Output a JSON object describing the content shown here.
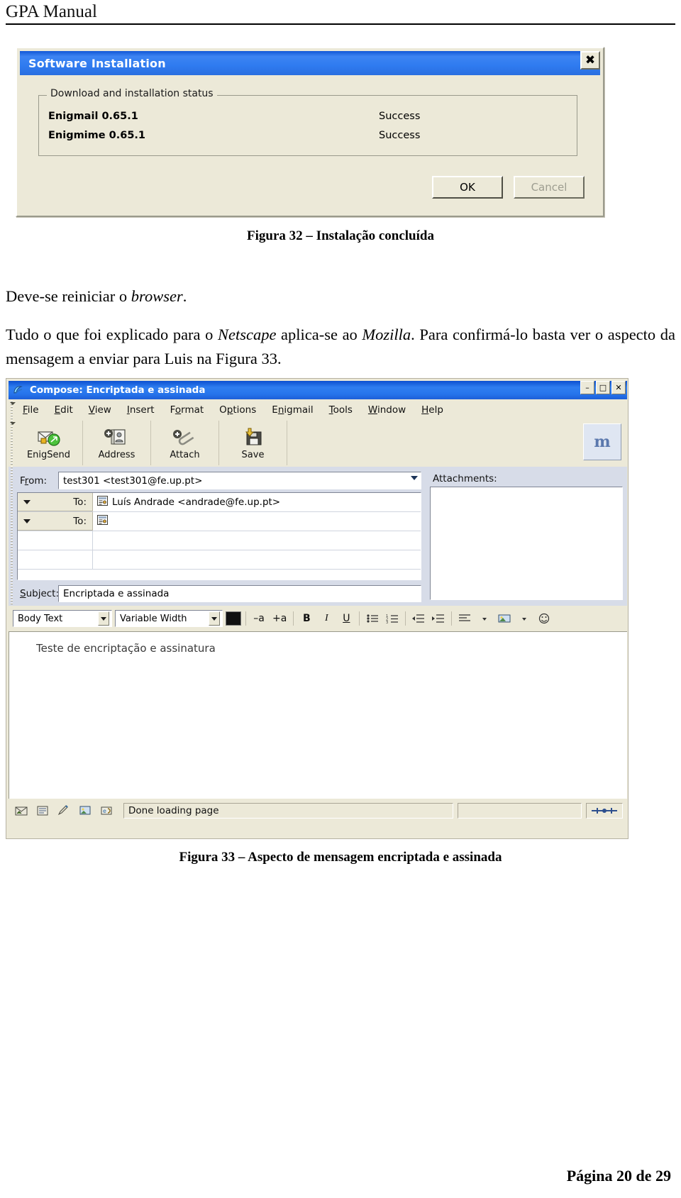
{
  "header": {
    "title": "GPA Manual"
  },
  "figure32": {
    "window_title": "Software Installation",
    "close_icon": "close-icon",
    "close_glyph": "✖",
    "group_legend": "Download and installation status",
    "items": [
      {
        "name": "Enigmail 0.65.1",
        "status": "Success"
      },
      {
        "name": "Enigmime 0.65.1",
        "status": "Success"
      }
    ],
    "ok_label": "OK",
    "cancel_label": "Cancel",
    "caption": "Figura 32 – Instalação concluída"
  },
  "body": {
    "para1_a": "Deve-se reiniciar o ",
    "para1_i": "browser",
    "para1_b": ".",
    "para2_a": "Tudo o que foi explicado para o ",
    "para2_i1": "Netscape",
    "para2_b": " aplica-se ao ",
    "para2_i2": "Mozilla",
    "para2_c": ". Para confirmá-lo basta ver o aspecto da mensagem a enviar para Luis na Figura 33."
  },
  "figure33": {
    "window_title": "Compose: Encriptada e assinada",
    "app_icon": "mozilla-compose-icon",
    "window_buttons": [
      {
        "name": "minimize-button",
        "glyph": "–"
      },
      {
        "name": "maximize-button",
        "glyph": "□"
      },
      {
        "name": "close-button",
        "glyph": "✕"
      }
    ],
    "menus": [
      {
        "pre": "",
        "hot": "F",
        "post": "ile"
      },
      {
        "pre": "",
        "hot": "E",
        "post": "dit"
      },
      {
        "pre": "",
        "hot": "V",
        "post": "iew"
      },
      {
        "pre": "",
        "hot": "I",
        "post": "nsert"
      },
      {
        "pre": "F",
        "hot": "o",
        "post": "rmat"
      },
      {
        "pre": "O",
        "hot": "p",
        "post": "tions"
      },
      {
        "pre": "E",
        "hot": "n",
        "post": "igmail"
      },
      {
        "pre": "",
        "hot": "T",
        "post": "ools"
      },
      {
        "pre": "",
        "hot": "W",
        "post": "indow"
      },
      {
        "pre": "",
        "hot": "H",
        "post": "elp"
      }
    ],
    "toolbar": [
      {
        "label": "EnigSend",
        "icon": "enigsend-icon"
      },
      {
        "label": "Address",
        "icon": "address-book-icon"
      },
      {
        "label": "Attach",
        "icon": "paperclip-attach-icon"
      },
      {
        "label": "Save",
        "icon": "floppy-save-icon"
      }
    ],
    "brand_glyph": "m",
    "from": {
      "label": "From:",
      "value": "test301 <test301@fe.up.pt>"
    },
    "recipients": [
      {
        "type": "To:",
        "value": "Luís Andrade <andrade@fe.up.pt>",
        "icon": "contact-card-icon"
      },
      {
        "type": "To:",
        "value": "",
        "icon": "contact-card-icon"
      }
    ],
    "subject": {
      "label": "Subject:",
      "value": "Encriptada e assinada"
    },
    "attachments": {
      "label": "Attachments:",
      "items": []
    },
    "format_bar": {
      "paragraph_style": "Body Text",
      "font_family": "Variable Width",
      "color_swatch": "#111111",
      "decrease_font": "–a",
      "increase_font": "+a",
      "bold": "B",
      "italic": "I",
      "underline": "U",
      "bullet_list": "bullet-list-icon",
      "number_list": "numbered-list-icon",
      "outdent": "outdent-icon",
      "indent": "indent-icon",
      "align": "align-icon",
      "insert_image": "insert-image-icon",
      "smiley": "smiley-icon"
    },
    "message_body": "Teste de encriptação e assinatura",
    "status": {
      "message": "Done loading page",
      "icons": [
        "mail-status-icon",
        "address-status-icon",
        "compose-status-icon",
        "image-status-icon",
        "security-status-icon"
      ],
      "end_icon": "resize-grip-icon"
    },
    "caption": "Figura 33 – Aspecto de mensagem encriptada e assinada"
  },
  "footer": {
    "page": "Página 20 de 29"
  }
}
